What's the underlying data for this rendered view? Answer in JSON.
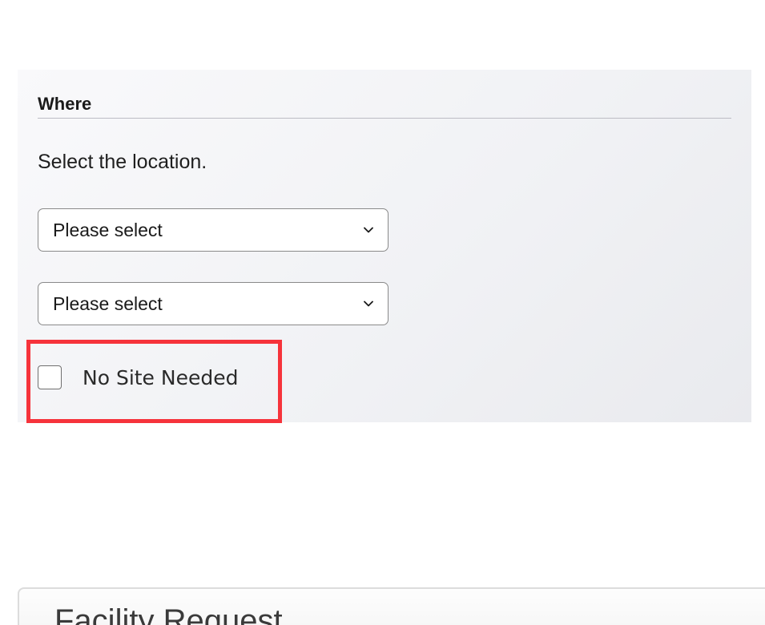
{
  "where_section": {
    "heading": "Where",
    "instruction": "Select the location.",
    "selects": [
      {
        "value": "Please select"
      },
      {
        "value": "Please select"
      }
    ],
    "no_site_checkbox": {
      "label": "No Site Needed",
      "checked": false
    }
  },
  "facility_card": {
    "title": "Facility Request"
  },
  "colors": {
    "highlight": "#f6333b",
    "panel_bg": "#f1f2f5"
  },
  "icons": {
    "select_arrow": "chevron-down-icon"
  }
}
